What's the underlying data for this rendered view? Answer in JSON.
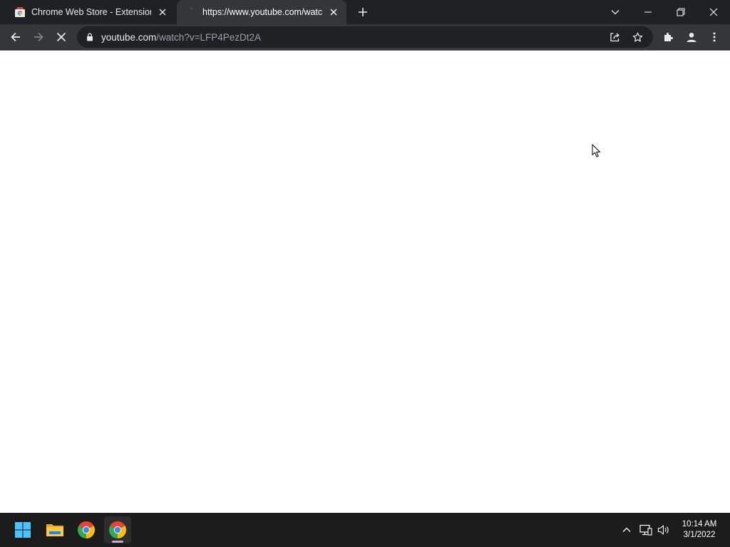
{
  "tabs": [
    {
      "title": "Chrome Web Store - Extensions",
      "favicon": "chrome-web-store-icon",
      "active": false
    },
    {
      "title": "https://www.youtube.com/watch",
      "favicon": "loading-icon",
      "active": true
    }
  ],
  "omnibox": {
    "host": "youtube.com",
    "path": "/watch?v=LFP4PezDt2A"
  },
  "taskbar": {
    "apps": [
      "start-icon",
      "file-explorer-icon",
      "chrome-icon",
      "chrome-icon"
    ],
    "clock": {
      "time": "10:14 AM",
      "date": "3/1/2022"
    }
  },
  "colors": {
    "tabstrip_bg": "#202124",
    "toolbar_bg": "#35363a",
    "omnibox_bg": "#202124",
    "taskbar_bg": "#1c1c1c"
  }
}
